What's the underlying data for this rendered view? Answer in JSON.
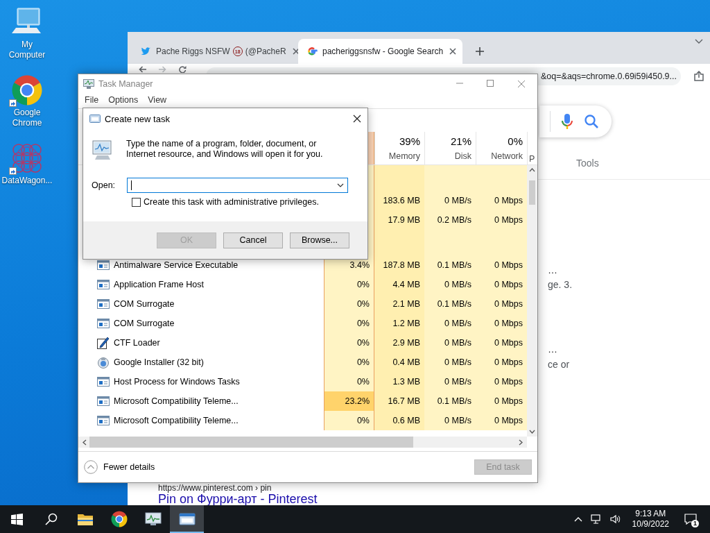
{
  "desktop_icons": [
    {
      "label": "My Computer",
      "kind": "computer",
      "shortcut": false
    },
    {
      "label": "Google Chrome",
      "kind": "chrome",
      "shortcut": true
    },
    {
      "label": "DataWagon...",
      "kind": "pattern",
      "shortcut": true
    }
  ],
  "browser": {
    "tabs": [
      {
        "label": "Pache Riggs NSFW",
        "badge": "18",
        "label_tail": "(@PacheR",
        "selected": false
      },
      {
        "label": "pacheriggsnsfw - Google Search",
        "selected": true
      }
    ],
    "address": "&oq=&aqs=chrome.0.69i59i450.9...",
    "tools_label": "Tools",
    "snippets": [
      {
        "text": "…",
        "kind": "title"
      },
      {
        "text": "ge. 3.",
        "kind": "body"
      },
      {
        "text": "…",
        "kind": "title"
      },
      {
        "text": "ce or",
        "kind": "body"
      }
    ],
    "result": {
      "url": "https://www.pinterest.com › pin",
      "title": "Pin on Фурри-арт - Pinterest"
    }
  },
  "task_manager": {
    "title": "Task Manager",
    "menu": [
      "File",
      "Options",
      "View"
    ],
    "columns": [
      {
        "value": "39%",
        "label": "Memory"
      },
      {
        "value": "21%",
        "label": "Disk"
      },
      {
        "value": "0%",
        "label": "Network"
      },
      {
        "label": "P"
      }
    ],
    "rows": [
      {
        "kind": "group"
      },
      {
        "kind": "process",
        "memory": "183.6 MB",
        "disk": "0 MB/s",
        "network": "0 Mbps"
      },
      {
        "kind": "process",
        "memory": "17.9 MB",
        "disk": "0.2 MB/s",
        "network": "0 Mbps"
      },
      {
        "kind": "group"
      },
      {
        "kind": "process",
        "name": "Antimalware Service Executable",
        "cpu": "3.4%",
        "memory": "187.8 MB",
        "disk": "0.1 MB/s",
        "network": "0 Mbps",
        "cpu_high": false
      },
      {
        "kind": "process",
        "name": "Application Frame Host",
        "cpu": "0%",
        "memory": "4.4 MB",
        "disk": "0 MB/s",
        "network": "0 Mbps",
        "cpu_high": false
      },
      {
        "kind": "process",
        "name": "COM Surrogate",
        "cpu": "0%",
        "memory": "2.1 MB",
        "disk": "0.1 MB/s",
        "network": "0 Mbps",
        "cpu_high": false
      },
      {
        "kind": "process",
        "name": "COM Surrogate",
        "cpu": "0%",
        "memory": "1.2 MB",
        "disk": "0 MB/s",
        "network": "0 Mbps",
        "cpu_high": false
      },
      {
        "kind": "process",
        "name": "CTF Loader",
        "cpu": "0%",
        "memory": "2.9 MB",
        "disk": "0 MB/s",
        "network": "0 Mbps",
        "cpu_high": false
      },
      {
        "kind": "process",
        "name": "Google Installer (32 bit)",
        "cpu": "0%",
        "memory": "0.4 MB",
        "disk": "0 MB/s",
        "network": "0 Mbps",
        "cpu_high": false
      },
      {
        "kind": "process",
        "name": "Host Process for Windows Tasks",
        "cpu": "0%",
        "memory": "1.3 MB",
        "disk": "0 MB/s",
        "network": "0 Mbps",
        "cpu_high": false
      },
      {
        "kind": "process",
        "name": "Microsoft Compatibility Teleme...",
        "cpu": "23.2%",
        "memory": "16.7 MB",
        "disk": "0.1 MB/s",
        "network": "0 Mbps",
        "cpu_high": true
      },
      {
        "kind": "process",
        "name": "Microsoft Compatibility Teleme...",
        "cpu": "0%",
        "memory": "0.6 MB",
        "disk": "0 MB/s",
        "network": "0 Mbps",
        "cpu_high": false
      }
    ],
    "footer": {
      "toggle": "Fewer details",
      "end_task": {
        "label": "End task",
        "disabled": true
      }
    }
  },
  "dialog": {
    "title": "Create new task",
    "message": "Type the name of a program, folder, document, or Internet resource, and Windows will open it for you.",
    "open_label": "Open:",
    "admin_checkbox": {
      "label": "Create this task with administrative privileges.",
      "checked": false
    },
    "buttons": [
      {
        "label": "OK",
        "disabled": true
      },
      {
        "label": "Cancel",
        "disabled": false
      },
      {
        "label": "Browse...",
        "disabled": false
      }
    ]
  },
  "taskbar": {
    "apps": [
      {
        "kind": "explorer",
        "active": false
      },
      {
        "kind": "chrome",
        "active": false
      },
      {
        "kind": "taskmgr",
        "active": false
      },
      {
        "kind": "run",
        "active": true
      }
    ],
    "time": "9:13 AM",
    "date": "10/9/2022",
    "notifications": "1"
  }
}
